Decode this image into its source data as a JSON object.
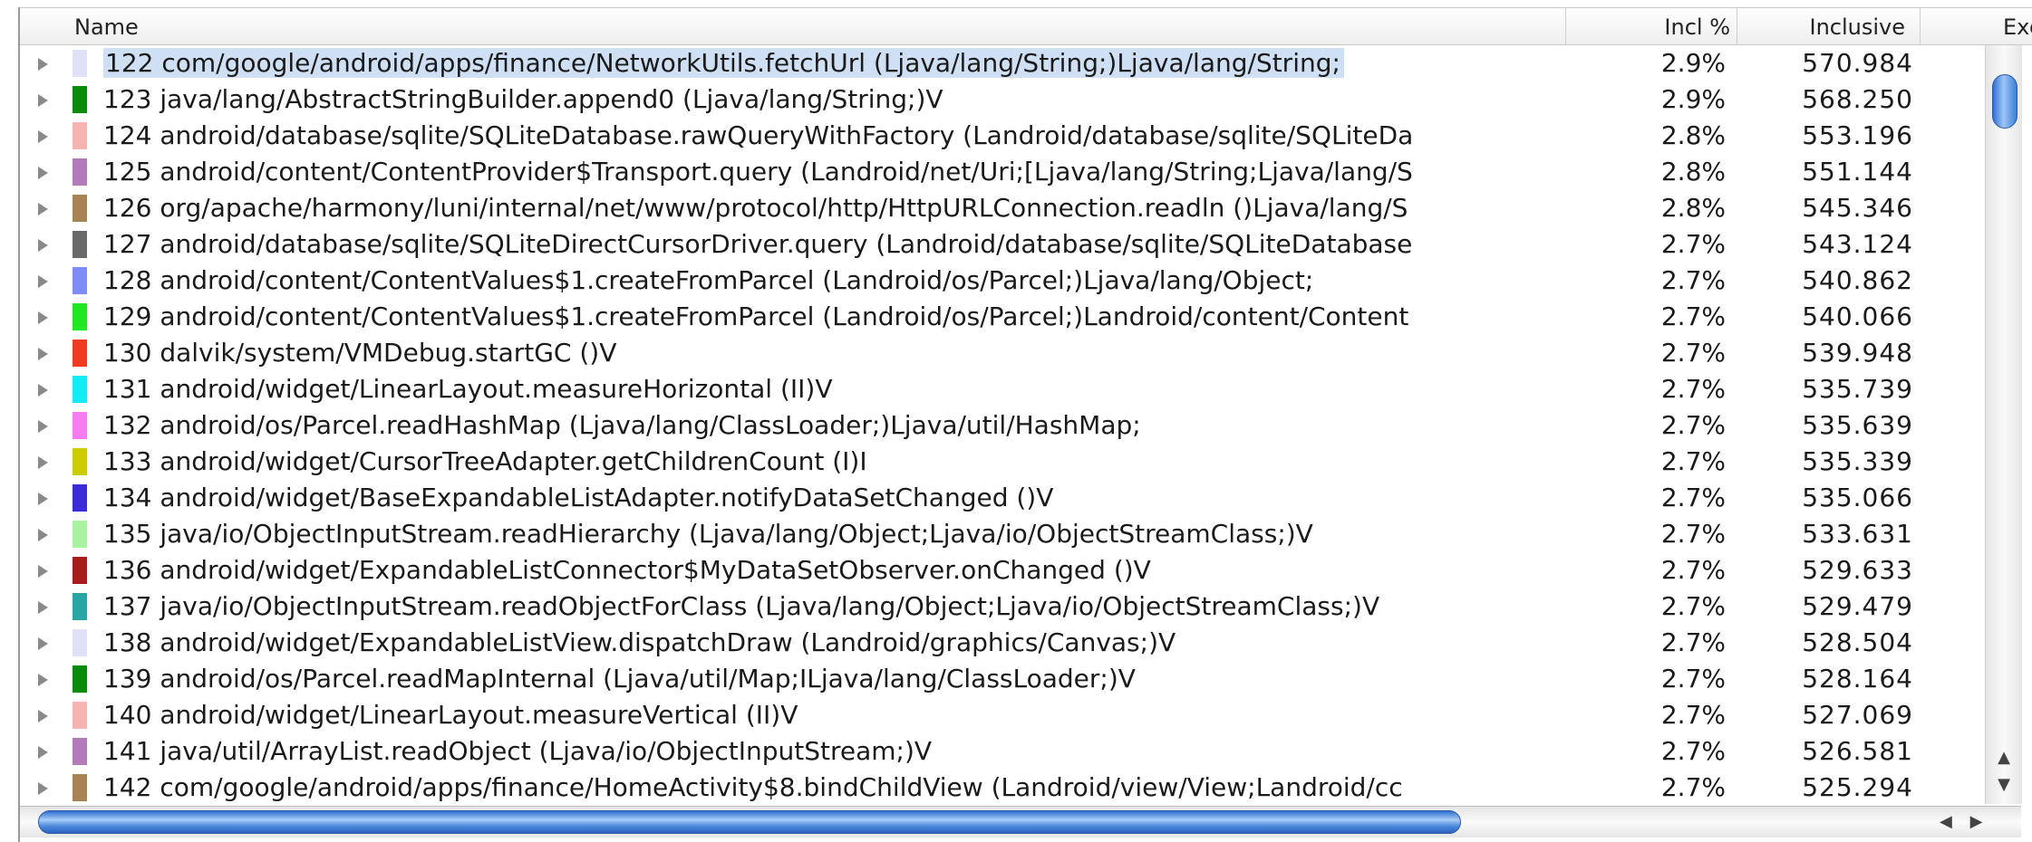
{
  "columns": {
    "name": "Name",
    "incl_pct": "Incl %",
    "inclusive": "Inclusive",
    "exclusive_partial": "Exc"
  },
  "rows": [
    {
      "text": "122 com/google/android/apps/finance/NetworkUtils.fetchUrl (Ljava/lang/String;)Ljava/lang/String;",
      "pct": "2.9%",
      "incl": "570.984",
      "color": "#e0e0f8",
      "selected": true
    },
    {
      "text": "123 java/lang/AbstractStringBuilder.append0 (Ljava/lang/String;)V",
      "pct": "2.9%",
      "incl": "568.250",
      "color": "#0a8a0a"
    },
    {
      "text": "124 android/database/sqlite/SQLiteDatabase.rawQueryWithFactory (Landroid/database/sqlite/SQLiteDa",
      "pct": "2.8%",
      "incl": "553.196",
      "color": "#f6b3b0"
    },
    {
      "text": "125 android/content/ContentProvider$Transport.query (Landroid/net/Uri;[Ljava/lang/String;Ljava/lang/S",
      "pct": "2.8%",
      "incl": "551.144",
      "color": "#b27ab8"
    },
    {
      "text": "126 org/apache/harmony/luni/internal/net/www/protocol/http/HttpURLConnection.readln ()Ljava/lang/S",
      "pct": "2.8%",
      "incl": "545.346",
      "color": "#a88455"
    },
    {
      "text": "127 android/database/sqlite/SQLiteDirectCursorDriver.query (Landroid/database/sqlite/SQLiteDatabase",
      "pct": "2.7%",
      "incl": "543.124",
      "color": "#6a6a6a"
    },
    {
      "text": "128 android/content/ContentValues$1.createFromParcel (Landroid/os/Parcel;)Ljava/lang/Object;",
      "pct": "2.7%",
      "incl": "540.862",
      "color": "#7f8cf6"
    },
    {
      "text": "129 android/content/ContentValues$1.createFromParcel (Landroid/os/Parcel;)Landroid/content/Content",
      "pct": "2.7%",
      "incl": "540.066",
      "color": "#22e622"
    },
    {
      "text": "130 dalvik/system/VMDebug.startGC ()V",
      "pct": "2.7%",
      "incl": "539.948",
      "color": "#f03a22"
    },
    {
      "text": "131 android/widget/LinearLayout.measureHorizontal (II)V",
      "pct": "2.7%",
      "incl": "535.739",
      "color": "#12ecf4"
    },
    {
      "text": "132 android/os/Parcel.readHashMap (Ljava/lang/ClassLoader;)Ljava/util/HashMap;",
      "pct": "2.7%",
      "incl": "535.639",
      "color": "#f67cf0"
    },
    {
      "text": "133 android/widget/CursorTreeAdapter.getChildrenCount (I)I",
      "pct": "2.7%",
      "incl": "535.339",
      "color": "#cccc00"
    },
    {
      "text": "134 android/widget/BaseExpandableListAdapter.notifyDataSetChanged ()V",
      "pct": "2.7%",
      "incl": "535.066",
      "color": "#3a2ad8"
    },
    {
      "text": "135 java/io/ObjectInputStream.readHierarchy (Ljava/lang/Object;Ljava/io/ObjectStreamClass;)V",
      "pct": "2.7%",
      "incl": "533.631",
      "color": "#a8f2a2"
    },
    {
      "text": "136 android/widget/ExpandableListConnector$MyDataSetObserver.onChanged ()V",
      "pct": "2.7%",
      "incl": "529.633",
      "color": "#a81c1c"
    },
    {
      "text": "137 java/io/ObjectInputStream.readObjectForClass (Ljava/lang/Object;Ljava/io/ObjectStreamClass;)V",
      "pct": "2.7%",
      "incl": "529.479",
      "color": "#2aa5a5"
    },
    {
      "text": "138 android/widget/ExpandableListView.dispatchDraw (Landroid/graphics/Canvas;)V",
      "pct": "2.7%",
      "incl": "528.504",
      "color": "#e0e0f8"
    },
    {
      "text": "139 android/os/Parcel.readMapInternal (Ljava/util/Map;ILjava/lang/ClassLoader;)V",
      "pct": "2.7%",
      "incl": "528.164",
      "color": "#0a8a0a"
    },
    {
      "text": "140 android/widget/LinearLayout.measureVertical (II)V",
      "pct": "2.7%",
      "incl": "527.069",
      "color": "#f6b3b0"
    },
    {
      "text": "141 java/util/ArrayList.readObject (Ljava/io/ObjectInputStream;)V",
      "pct": "2.7%",
      "incl": "526.581",
      "color": "#b27ab8"
    },
    {
      "text": "142 com/google/android/apps/finance/HomeActivity$8.bindChildView (Landroid/view/View;Landroid/cc",
      "pct": "2.7%",
      "incl": "525.294",
      "color": "#a88455"
    }
  ],
  "icons": {
    "expand": "disclosure-triangle-icon",
    "scroll_up": "arrow-up-icon",
    "scroll_down": "arrow-down-icon",
    "scroll_left": "arrow-left-icon",
    "scroll_right": "arrow-right-icon"
  }
}
